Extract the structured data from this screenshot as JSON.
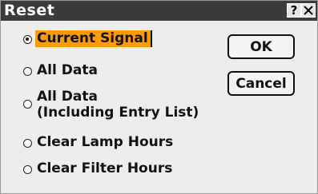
{
  "dialog": {
    "title": "Reset",
    "help_label": "?"
  },
  "options": [
    {
      "lines": [
        "Current Signal"
      ],
      "checked": true
    },
    {
      "lines": [
        "All Data"
      ],
      "checked": false
    },
    {
      "lines": [
        "All Data",
        "(Including Entry List)"
      ],
      "checked": false
    },
    {
      "lines": [
        "Clear Lamp Hours"
      ],
      "checked": false
    },
    {
      "lines": [
        "Clear Filter Hours"
      ],
      "checked": false
    }
  ],
  "buttons": {
    "ok_label": "OK",
    "cancel_label": "Cancel"
  },
  "colors": {
    "title_bar": "#3b3b3b",
    "selection_highlight": "#ff9a00",
    "dialog_background": "#ededed"
  }
}
